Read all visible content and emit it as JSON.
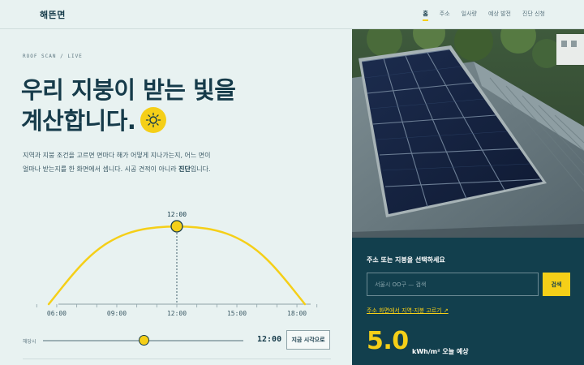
{
  "header": {
    "logo": "해뜬면",
    "nav": [
      "홈",
      "주소",
      "일사량",
      "예상 발전",
      "진단 신청"
    ],
    "active_nav": "홈"
  },
  "hero": {
    "eyebrow": "ROOF SCAN / LIVE",
    "headline_line1": "우리 지붕이 받는 빛을",
    "headline_line2": "계산합니다.",
    "desc_line1": "지역과 지붕 조건을 고르면 면마다 해가 어떻게 지나가는지, 어느 면이",
    "desc_line2_prefix": "얼마나 받는지를 한 화면에서 셉니다. 시공 견적이 아니라 ",
    "desc_line2_strong": "진단",
    "desc_line2_suffix": "입니다."
  },
  "chart_data": {
    "type": "line",
    "x_ticks": [
      "06:00",
      "09:00",
      "12:00",
      "15:00",
      "18:00"
    ],
    "peak_label": "12:00",
    "current_time": "12:00",
    "sun_path": [
      {
        "time": 5.6,
        "altitude": 0
      },
      {
        "time": 7,
        "altitude": 0.45
      },
      {
        "time": 8,
        "altitude": 0.7
      },
      {
        "time": 9,
        "altitude": 0.86
      },
      {
        "time": 10,
        "altitude": 0.95
      },
      {
        "time": 11,
        "altitude": 0.99
      },
      {
        "time": 12,
        "altitude": 1.0
      },
      {
        "time": 13,
        "altitude": 0.99
      },
      {
        "time": 14,
        "altitude": 0.95
      },
      {
        "time": 15,
        "altitude": 0.86
      },
      {
        "time": 16,
        "altitude": 0.7
      },
      {
        "time": 17,
        "altitude": 0.45
      },
      {
        "time": 18.4,
        "altitude": 0
      }
    ]
  },
  "slider": {
    "label": "해당시",
    "value": "12:00",
    "position_fraction": 0.5,
    "now_button": "지금 시각으로"
  },
  "panel": {
    "title": "주소 또는 지붕을 선택하세요",
    "search_placeholder": "서울시 OO구 — 검색",
    "search_button": "검색",
    "map_link": "주소 화면에서 지역·지붕 고르기 ↗",
    "big_value": "5.0",
    "unit_label": "kWh/m² 오늘 예상"
  },
  "colors": {
    "accent": "#f5cf18",
    "navy": "#163b4a",
    "panel": "#123f4d",
    "background": "#e8f2f1"
  }
}
